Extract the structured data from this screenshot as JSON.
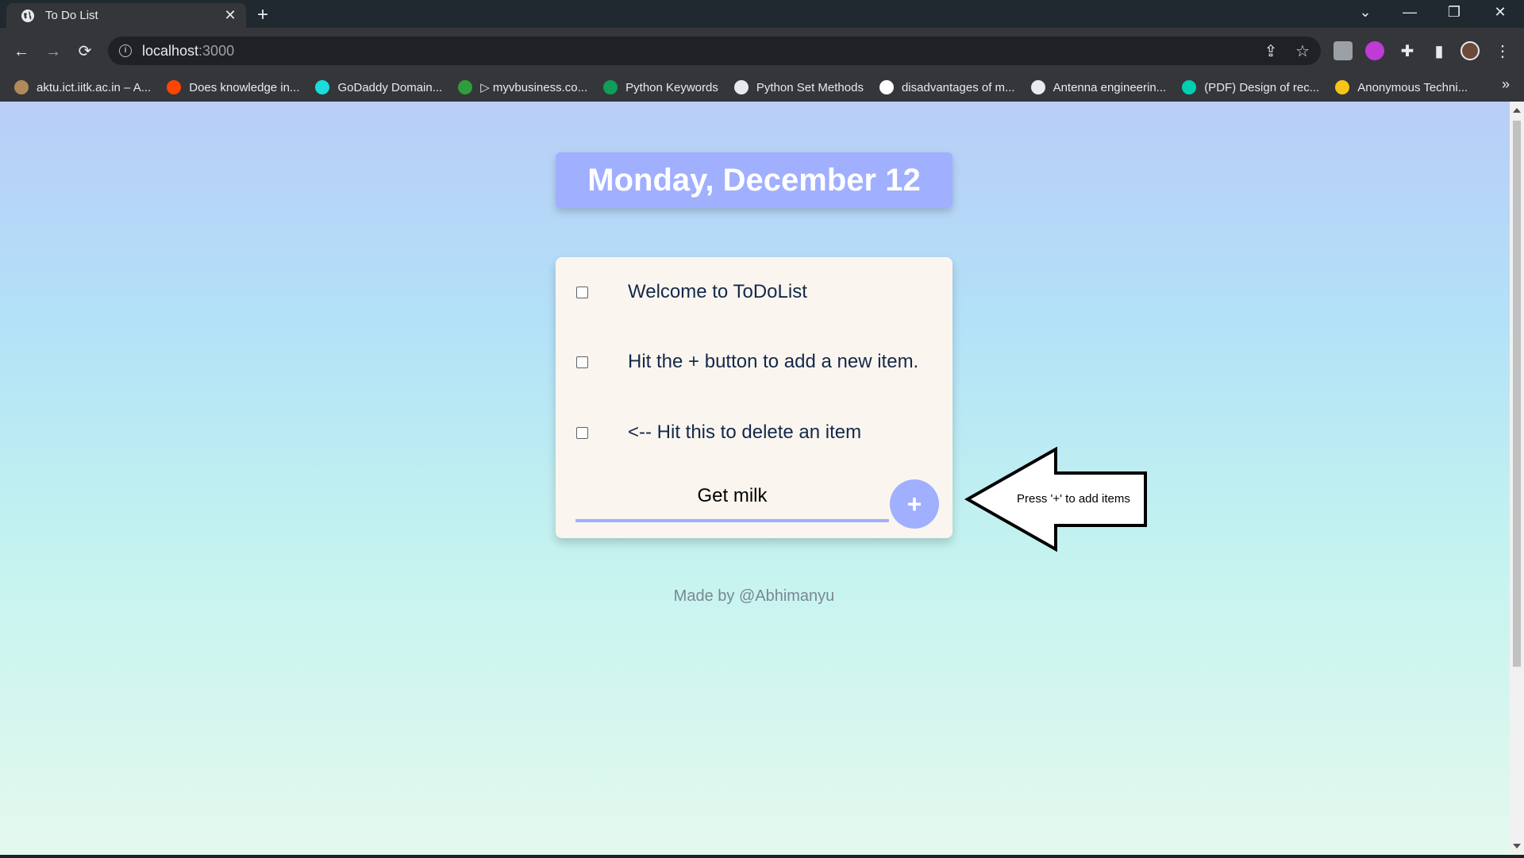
{
  "browser": {
    "tab_title": "To Do List",
    "tab_close": "✕",
    "new_tab": "+",
    "url_host": "localhost",
    "url_port": ":3000",
    "window_controls": {
      "tab_search": "⌄",
      "minimize": "—",
      "restore": "❐",
      "close": "✕"
    },
    "nav": {
      "back": "←",
      "forward": "→",
      "reload": "⟳"
    },
    "omnibox_icons": {
      "share": "⇪",
      "bookmark_star": "☆",
      "extensions": "✚",
      "side_panel": "▮",
      "menu": "⋮"
    },
    "bookmarks_more": "»",
    "bookmarks": [
      {
        "label": "aktu.ict.iitk.ac.in – A...",
        "icon_color": "#b08a5a"
      },
      {
        "label": "Does knowledge in...",
        "icon_color": "#ff4500"
      },
      {
        "label": "GoDaddy Domain...",
        "icon_color": "#1bdbdb"
      },
      {
        "label": "▷ myvbusiness.co...",
        "icon_color": "#2e9e3c"
      },
      {
        "label": "Python Keywords",
        "icon_color": "#0f9d58"
      },
      {
        "label": "Python Set Methods",
        "icon_color": "#e8eaed"
      },
      {
        "label": "disadvantages of m...",
        "icon_color": "#ffffff"
      },
      {
        "label": "Antenna engineerin...",
        "icon_color": "#e8eaed"
      },
      {
        "label": "(PDF) Design of rec...",
        "icon_color": "#00d0af"
      },
      {
        "label": "Anonymous Techni...",
        "icon_color": "#f5c518"
      }
    ]
  },
  "app": {
    "date_heading": "Monday, December 12",
    "items": [
      {
        "text": "Welcome to ToDoList",
        "checked": false
      },
      {
        "text": "Hit the + button to add a new item.",
        "checked": false
      },
      {
        "text": "<-- Hit this to delete an item",
        "checked": false
      }
    ],
    "new_item_value": "Get milk",
    "add_button": "+",
    "annotation": "Press '+' to add items",
    "footer": "Made by @Abhimanyu"
  },
  "colors": {
    "accent": "#a1afff",
    "card_bg": "#faf6ef",
    "item_text": "#14284a"
  }
}
